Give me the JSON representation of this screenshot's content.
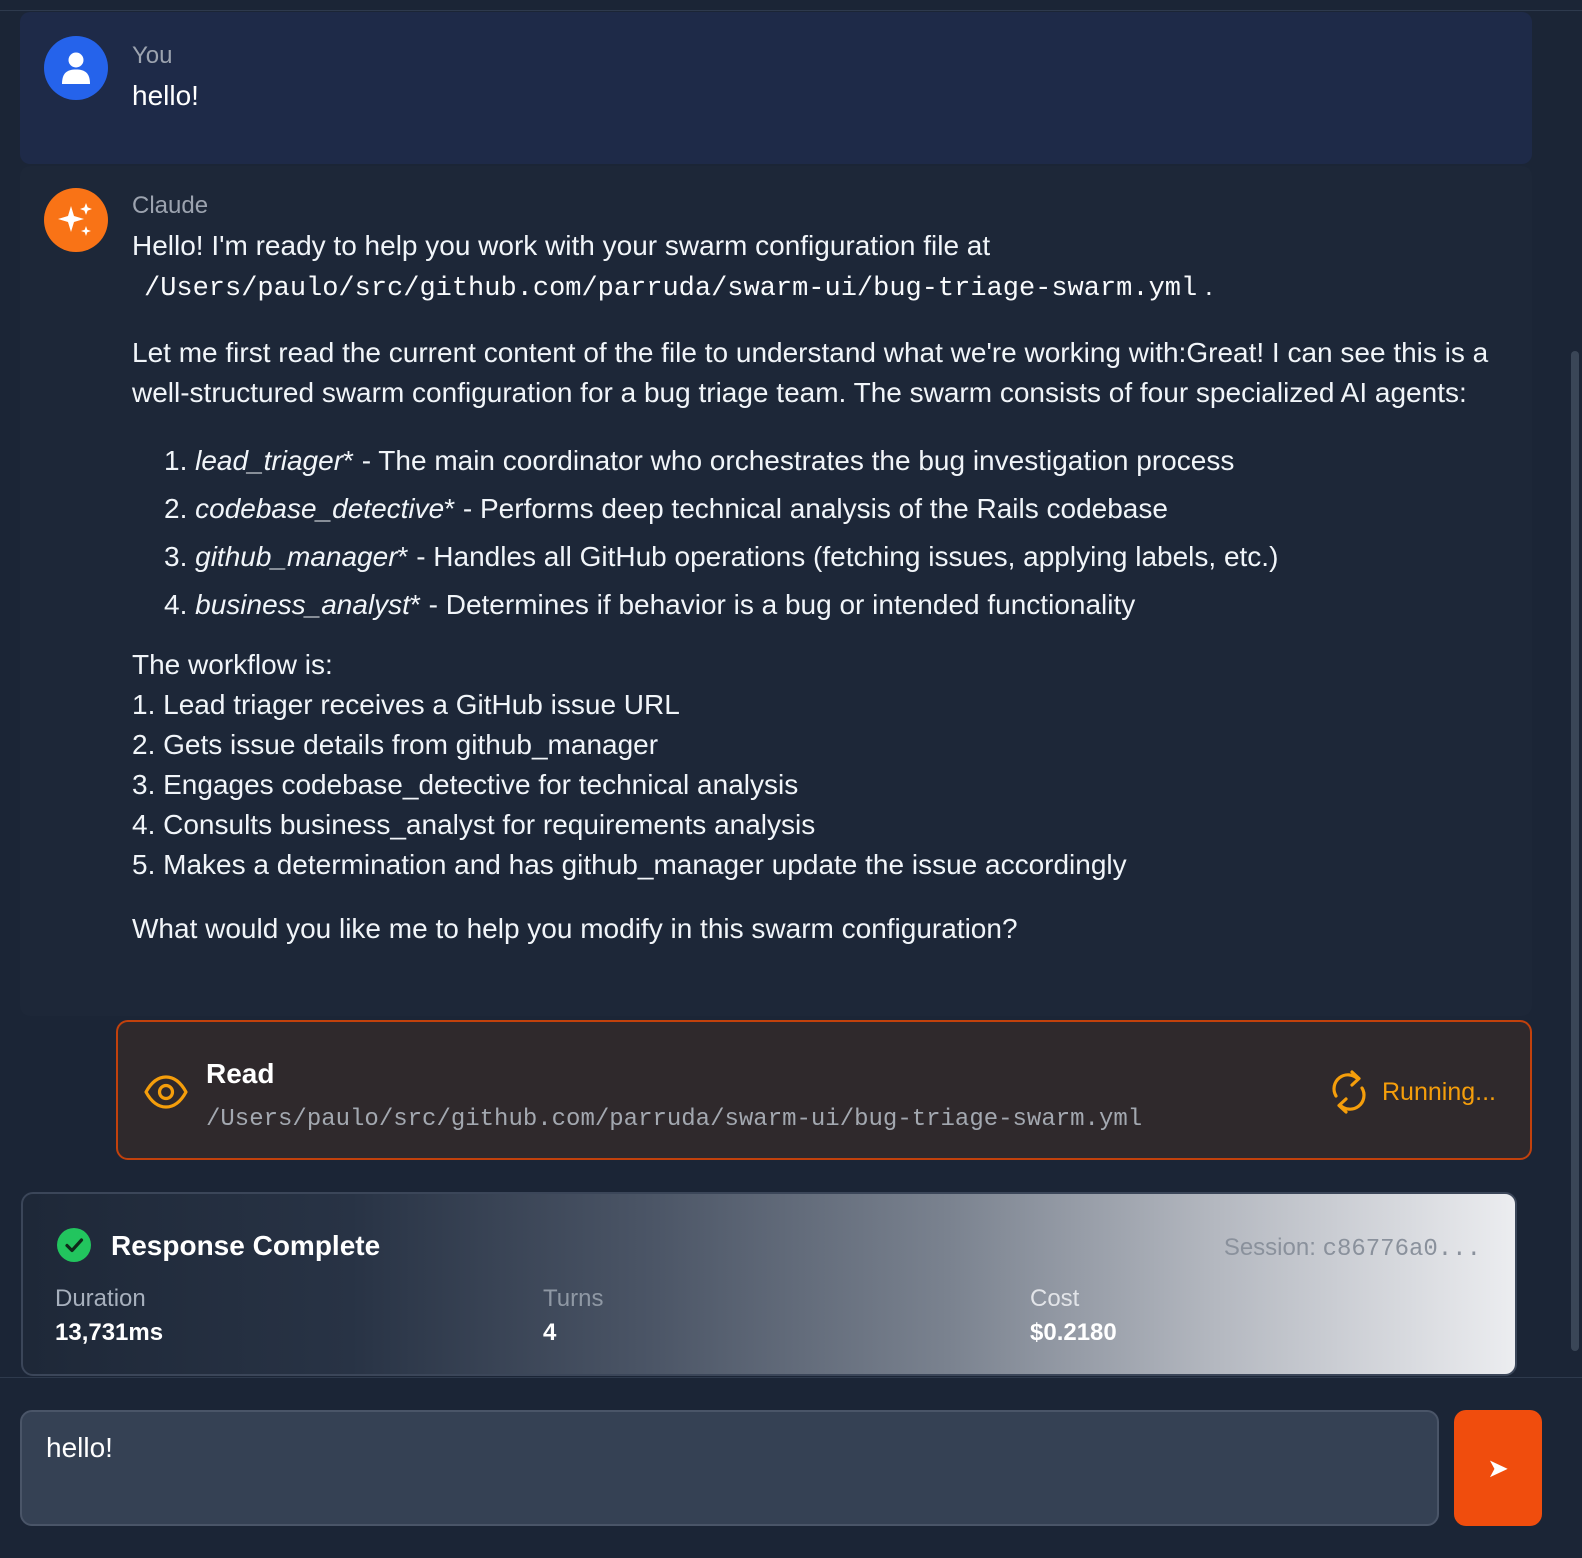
{
  "colors": {
    "user_avatar": "#2563eb",
    "claude_avatar": "#f97316",
    "tool_border": "#c2410c",
    "status_running": "#f59e0b",
    "success_check": "#22c55e",
    "send_button": "#f04d0d"
  },
  "user_message": {
    "sender": "You",
    "avatar_icon": "user-icon",
    "text": "hello!"
  },
  "assistant_message": {
    "sender": "Claude",
    "avatar_icon": "sparkle-icon",
    "intro": "Hello! I'm ready to help you work with your swarm configuration file at",
    "file_path": "/Users/paulo/src/github.com/parruda/swarm-ui/bug-triage-swarm.yml",
    "path_suffix": ".",
    "paragraph": "Let me first read the current content of the file to understand what we're working with:Great! I can see this is a well-structured swarm configuration for a bug triage team. The swarm consists of four specialized AI agents:",
    "agents": [
      {
        "num": "1.",
        "name": "lead_triager",
        "desc": "* - The main coordinator who orchestrates the bug investigation process"
      },
      {
        "num": "2.",
        "name": "codebase_detective",
        "desc": "* - Performs deep technical analysis of the Rails codebase"
      },
      {
        "num": "3.",
        "name": "github_manager",
        "desc": "* - Handles all GitHub operations (fetching issues, applying labels, etc.)"
      },
      {
        "num": "4.",
        "name": "business_analyst",
        "desc": "* - Determines if behavior is a bug or intended functionality"
      }
    ],
    "workflow": [
      "The workflow is:",
      "1. Lead triager receives a GitHub issue URL",
      "2. Gets issue details from github_manager",
      "3. Engages codebase_detective for technical analysis",
      "4. Consults business_analyst for requirements analysis",
      "5. Makes a determination and has github_manager update the issue accordingly"
    ],
    "closing": "What would you like me to help you modify in this swarm configuration?"
  },
  "tool_call": {
    "icon": "eye-icon",
    "name": "Read",
    "path": "/Users/paulo/src/github.com/parruda/swarm-ui/bug-triage-swarm.yml",
    "status_icon": "refresh-icon",
    "status": "Running..."
  },
  "summary": {
    "icon": "check-circle-icon",
    "title": "Response Complete",
    "session_label": "Session:",
    "session_id": "c86776a0...",
    "stats": {
      "duration": {
        "label": "Duration",
        "value": "13,731ms"
      },
      "turns": {
        "label": "Turns",
        "value": "4"
      },
      "cost": {
        "label": "Cost",
        "value": "$0.2180"
      }
    }
  },
  "composer": {
    "value": "hello!",
    "send_icon": "send-arrow-icon",
    "send_glyph": "➤"
  }
}
